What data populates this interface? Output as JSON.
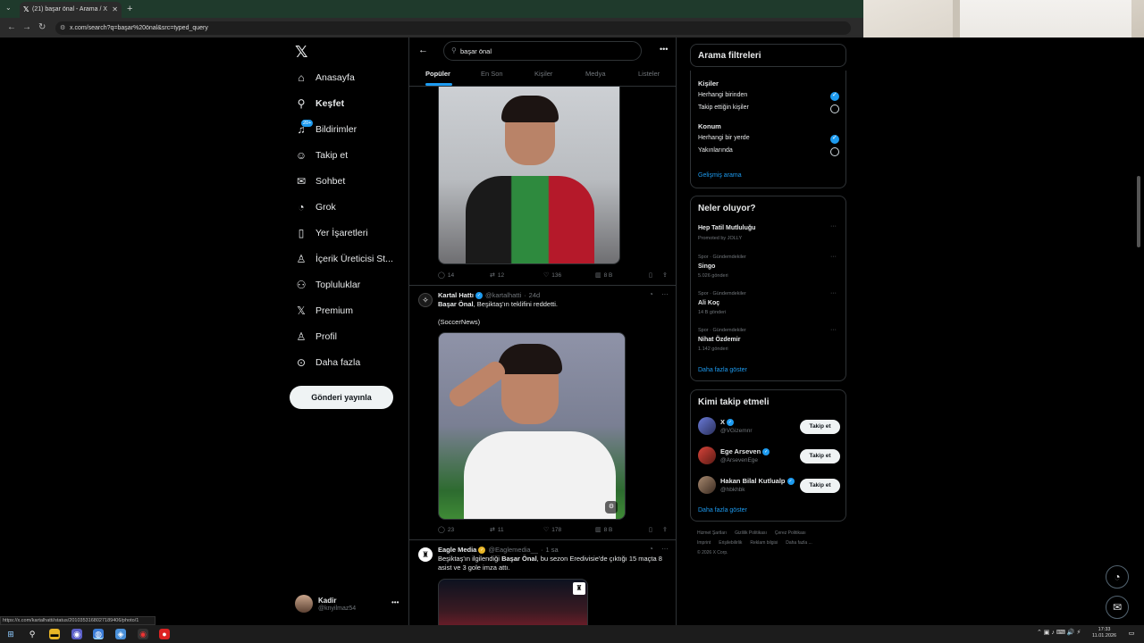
{
  "browser": {
    "tab_title": "(21) başar önal - Arama / X",
    "url": "x.com/search?q=başar%20önal&src=typed_query",
    "status_url": "https://x.com/kartalhatti/status/2010353168027189406/photo/1"
  },
  "sidebar": {
    "items": [
      {
        "label": "Anasayfa",
        "icon": "home-icon"
      },
      {
        "label": "Keşfet",
        "icon": "search-icon"
      },
      {
        "label": "Bildirimler",
        "icon": "bell-icon",
        "badge": "20+"
      },
      {
        "label": "Takip et",
        "icon": "add-person-icon"
      },
      {
        "label": "Sohbet",
        "icon": "mail-icon"
      },
      {
        "label": "Grok",
        "icon": "grok-icon"
      },
      {
        "label": "Yer İşaretleri",
        "icon": "bookmark-icon"
      },
      {
        "label": "İçerik Üreticisi St...",
        "icon": "creator-icon"
      },
      {
        "label": "Topluluklar",
        "icon": "communities-icon"
      },
      {
        "label": "Premium",
        "icon": "x-icon"
      },
      {
        "label": "Profil",
        "icon": "person-icon"
      },
      {
        "label": "Daha fazla",
        "icon": "more-circle-icon"
      }
    ],
    "post_button": "Gönderi yayınla",
    "account": {
      "name": "Kadir",
      "handle": "@knyilmaz54"
    }
  },
  "search": {
    "query": "başar önal",
    "tabs": [
      "Popüler",
      "En Son",
      "Kişiler",
      "Medya",
      "Listeler"
    ]
  },
  "tweets": [
    {
      "actions": {
        "replies": "14",
        "retweets": "12",
        "likes": "136",
        "views": "8 B"
      }
    },
    {
      "name": "Kartal Hattı",
      "handle": "@kartalhatti",
      "time": "24d",
      "bold": "Başar Önal",
      "text": ", Beşiktaş'ın teklifini reddetti.",
      "source": "(SoccerNews)",
      "actions": {
        "replies": "23",
        "retweets": "11",
        "likes": "178",
        "views": "8 B"
      }
    },
    {
      "name": "Eagle Media",
      "handle": "@Eaglemedia__",
      "time": "1 sa",
      "text_pre": "Beşiktaş'ın ilgilendiği ",
      "bold": "Başar Önal",
      "text_post": ", bu sezon Eredivisie'de çıktığı 15 maçta 8 asist ve 3 gole imza attı."
    }
  ],
  "filters": {
    "title": "Arama filtreleri",
    "people_heading": "Kişiler",
    "people_options": [
      "Herhangi birinden",
      "Takip ettiğin kişiler"
    ],
    "location_heading": "Konum",
    "location_options": [
      "Herhangi bir yerde",
      "Yakınlarında"
    ],
    "advanced_link": "Gelişmiş arama"
  },
  "trends": {
    "title": "Neler oluyor?",
    "items": [
      {
        "category": "",
        "title": "Hep Tatil Mutluluğu",
        "count": "Promoted by JOLLY"
      },
      {
        "category": "Spor · Gündemdekiler",
        "title": "Singo",
        "count": "5.026 gönderi"
      },
      {
        "category": "Spor · Gündemdekiler",
        "title": "Ali Koç",
        "count": "14 B gönderi"
      },
      {
        "category": "Spor · Gündemdekiler",
        "title": "Nihat Özdemir",
        "count": "1.142 gönderi"
      }
    ],
    "show_more": "Daha fazla göster"
  },
  "who_to_follow": {
    "title": "Kimi takip etmeli",
    "accounts": [
      {
        "name": "X",
        "handle": "@VGizemnr"
      },
      {
        "name": "Ege Arseven",
        "handle": "@ArsevenEge"
      },
      {
        "name": "Hakan Bilal Kutlualp",
        "handle": "@hbkhbk"
      }
    ],
    "follow_label": "Takip et",
    "show_more": "Daha fazla göster"
  },
  "footer": {
    "links": [
      "Hizmet Şartları",
      "Gizlilik Politikası",
      "Çerez Politikası",
      "Imprint",
      "Erişilebilirlik",
      "Reklam bilgisi",
      "Daha fazla ..."
    ],
    "copyright": "© 2026 X Corp."
  },
  "taskbar": {
    "time": "17:33",
    "date": "11.01.2026"
  },
  "colors": {
    "accent": "#1d9bf0",
    "background": "#000000",
    "border": "#2f3336",
    "muted": "#71767b"
  }
}
